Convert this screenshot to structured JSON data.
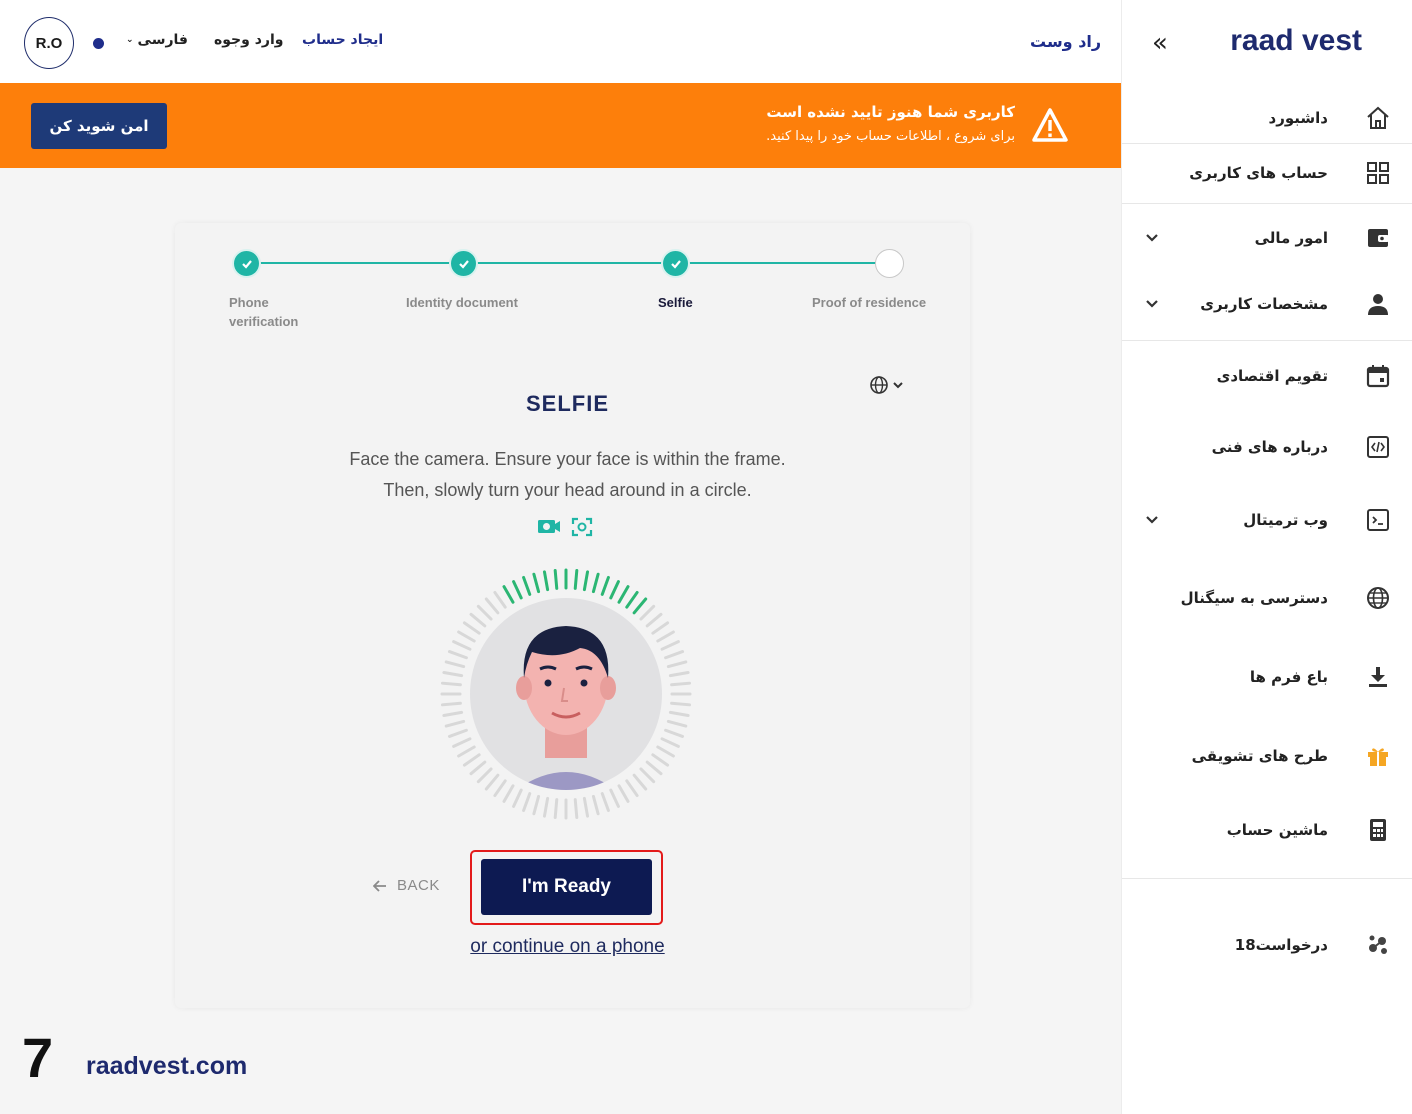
{
  "header": {
    "avatar_initials": "R.O",
    "language": "فارسی",
    "login": "وارد وجوه",
    "signup": "ایجاد حساب",
    "brand_link": "راد وست"
  },
  "banner": {
    "secure_button": "امن شوید کن",
    "title": "کاربری شما هنوز تایید نشده است",
    "subtitle": "برای شروع ، اطلاعات حساب خود را پیدا کنید.",
    "color": "#fd7f0b"
  },
  "stepper": {
    "steps": [
      {
        "line1": "Phone",
        "line2": "verification",
        "status": "done"
      },
      {
        "line1": "Identity document",
        "line2": "",
        "status": "done"
      },
      {
        "line1": "Selfie",
        "line2": "",
        "status": "current"
      },
      {
        "line1": "Proof of residence",
        "line2": "",
        "status": "pending"
      }
    ],
    "accent": "#1fb5a5"
  },
  "main": {
    "title": "SELFIE",
    "instruction_1": "Face the camera. Ensure your face is within the frame.",
    "instruction_2": "Then, slowly turn your head around in a circle.",
    "back_label": "BACK",
    "ready_label": "I'm Ready",
    "phone_link": "or continue on a phone"
  },
  "footer": {
    "step_number": "7",
    "site": "raadvest.com"
  },
  "sidebar": {
    "logo": "raad vest",
    "items": [
      {
        "label": "داشبورد",
        "icon": "home-icon",
        "has_chevron": false
      },
      {
        "label": "حساب های کاربری",
        "icon": "grid-icon",
        "has_chevron": false
      },
      {
        "label": "امور مالی",
        "icon": "wallet-icon",
        "has_chevron": true
      },
      {
        "label": "مشخصات کاربری",
        "icon": "user-icon",
        "has_chevron": true
      },
      {
        "label": "تقویم اقتصادی",
        "icon": "calendar-icon",
        "has_chevron": false
      },
      {
        "label": "درباره های فنی",
        "icon": "code-icon",
        "has_chevron": false
      },
      {
        "label": "وب ترمیتال",
        "icon": "terminal-icon",
        "has_chevron": true
      },
      {
        "label": "دسترسی به سیگنال",
        "icon": "globe-icon",
        "has_chevron": false
      },
      {
        "label": "باع فرم ها",
        "icon": "download-icon",
        "has_chevron": false
      },
      {
        "label": "طرح های تشویقی",
        "icon": "gift-icon",
        "has_chevron": false
      },
      {
        "label": "ماشین حساب",
        "icon": "calculator-icon",
        "has_chevron": false
      },
      {
        "label": "درخواست",
        "badge": "18",
        "icon": "requests-icon",
        "has_chevron": false
      }
    ]
  }
}
